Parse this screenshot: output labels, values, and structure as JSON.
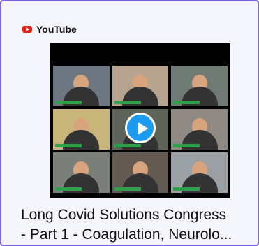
{
  "source": {
    "name": "YouTube",
    "icon": "youtube-logo-icon",
    "brand_color": "#e62117"
  },
  "video": {
    "title_line1": "Long Covid Solutions Congress",
    "title_line2": "- Part 1 - Coagulation, Neurolo...",
    "play_icon": "play-button-icon",
    "accent_color": "#1d9bf0"
  }
}
